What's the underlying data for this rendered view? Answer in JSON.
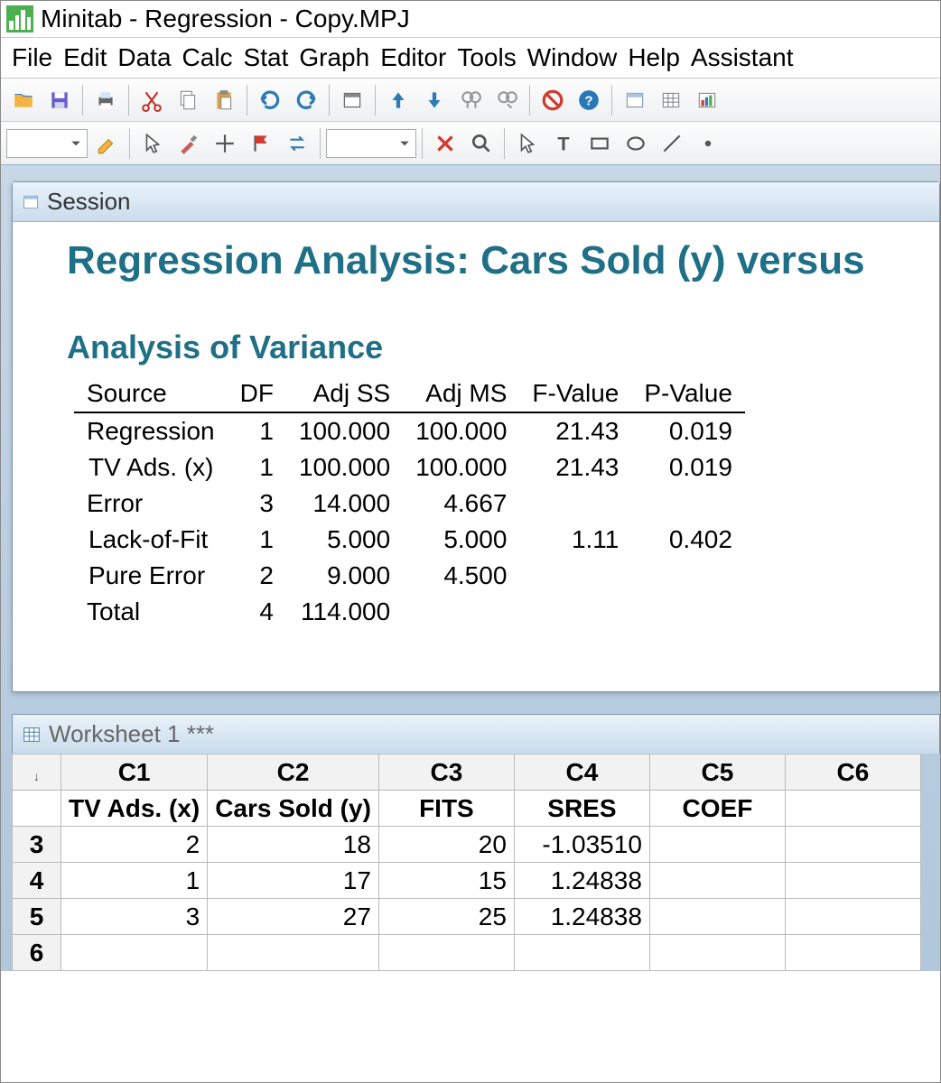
{
  "app": {
    "title": "Minitab - Regression - Copy.MPJ"
  },
  "menu": [
    "File",
    "Edit",
    "Data",
    "Calc",
    "Stat",
    "Graph",
    "Editor",
    "Tools",
    "Window",
    "Help",
    "Assistant"
  ],
  "session": {
    "window_title": "Session",
    "heading": "Regression Analysis: Cars Sold (y) versus ",
    "subheading": "Analysis of Variance",
    "columns": [
      "Source",
      "DF",
      "Adj SS",
      "Adj MS",
      "F-Value",
      "P-Value"
    ],
    "rows": [
      {
        "indent": 0,
        "source": "Regression",
        "df": "1",
        "adjss": "100.000",
        "adjms": "100.000",
        "f": "21.43",
        "p": "0.019"
      },
      {
        "indent": 1,
        "source": "TV Ads. (x)",
        "df": "1",
        "adjss": "100.000",
        "adjms": "100.000",
        "f": "21.43",
        "p": "0.019"
      },
      {
        "indent": 0,
        "source": "Error",
        "df": "3",
        "adjss": "14.000",
        "adjms": "4.667",
        "f": "",
        "p": ""
      },
      {
        "indent": 1,
        "source": "Lack-of-Fit",
        "df": "1",
        "adjss": "5.000",
        "adjms": "5.000",
        "f": "1.11",
        "p": "0.402"
      },
      {
        "indent": 1,
        "source": "Pure Error",
        "df": "2",
        "adjss": "9.000",
        "adjms": "4.500",
        "f": "",
        "p": ""
      },
      {
        "indent": 0,
        "source": "Total",
        "df": "4",
        "adjss": "114.000",
        "adjms": "",
        "f": "",
        "p": ""
      }
    ]
  },
  "worksheet": {
    "title": "Worksheet 1 ***",
    "col_ids": [
      "C1",
      "C2",
      "C3",
      "C4",
      "C5",
      "C6"
    ],
    "col_names": [
      "TV Ads. (x)",
      "Cars Sold (y)",
      "FITS",
      "SRES",
      "COEF",
      ""
    ],
    "rows": [
      {
        "n": "3",
        "cells": [
          "2",
          "18",
          "20",
          "-1.03510",
          "",
          ""
        ]
      },
      {
        "n": "4",
        "cells": [
          "1",
          "17",
          "15",
          "1.24838",
          "",
          ""
        ]
      },
      {
        "n": "5",
        "cells": [
          "3",
          "27",
          "25",
          "1.24838",
          "",
          ""
        ]
      },
      {
        "n": "6",
        "cells": [
          "",
          "",
          "",
          "",
          "",
          ""
        ]
      }
    ]
  },
  "chart_data": {
    "type": "table",
    "title": "Analysis of Variance",
    "columns": [
      "Source",
      "DF",
      "Adj SS",
      "Adj MS",
      "F-Value",
      "P-Value"
    ],
    "rows": [
      [
        "Regression",
        1,
        100.0,
        100.0,
        21.43,
        0.019
      ],
      [
        "TV Ads. (x)",
        1,
        100.0,
        100.0,
        21.43,
        0.019
      ],
      [
        "Error",
        3,
        14.0,
        4.667,
        null,
        null
      ],
      [
        "Lack-of-Fit",
        1,
        5.0,
        5.0,
        1.11,
        0.402
      ],
      [
        "Pure Error",
        2,
        9.0,
        4.5,
        null,
        null
      ],
      [
        "Total",
        4,
        114.0,
        null,
        null,
        null
      ]
    ]
  }
}
